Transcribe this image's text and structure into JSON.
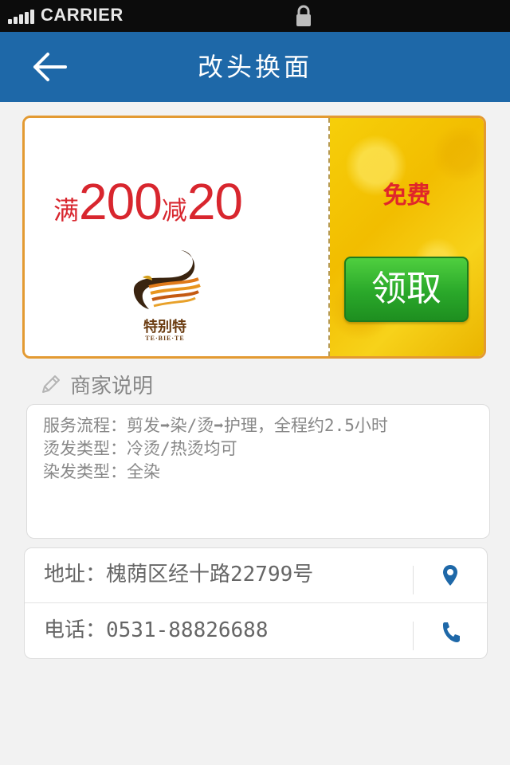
{
  "status_bar": {
    "carrier": "CARRIER"
  },
  "navbar": {
    "title": "改头换面"
  },
  "coupon": {
    "prefix": "满",
    "threshold": "200",
    "mid": "减",
    "discount": "20",
    "free_label": "免费",
    "claim_label": "领取",
    "logo_name": "特别特",
    "logo_pinyin": "TE·BIE·TE"
  },
  "merchant": {
    "section_title": "商家说明",
    "lines": [
      "服务流程：剪发➡染/烫➡护理，全程约2.5小时",
      "烫发类型：冷烫/热烫均可",
      "染发类型：全染"
    ],
    "address": "地址：槐荫区经十路22799号",
    "phone": "电话：0531-88826688"
  },
  "colors": {
    "navbar": "#1e68a8",
    "coupon_border": "#e39a32",
    "offer_red": "#d8262e",
    "claim_green": "#2aa82a",
    "icon_blue": "#1e68a8"
  },
  "icons": {
    "back": "arrow-left-icon",
    "lock": "lock-icon",
    "pencil": "pencil-icon",
    "location": "location-pin-icon",
    "phone": "phone-icon"
  }
}
